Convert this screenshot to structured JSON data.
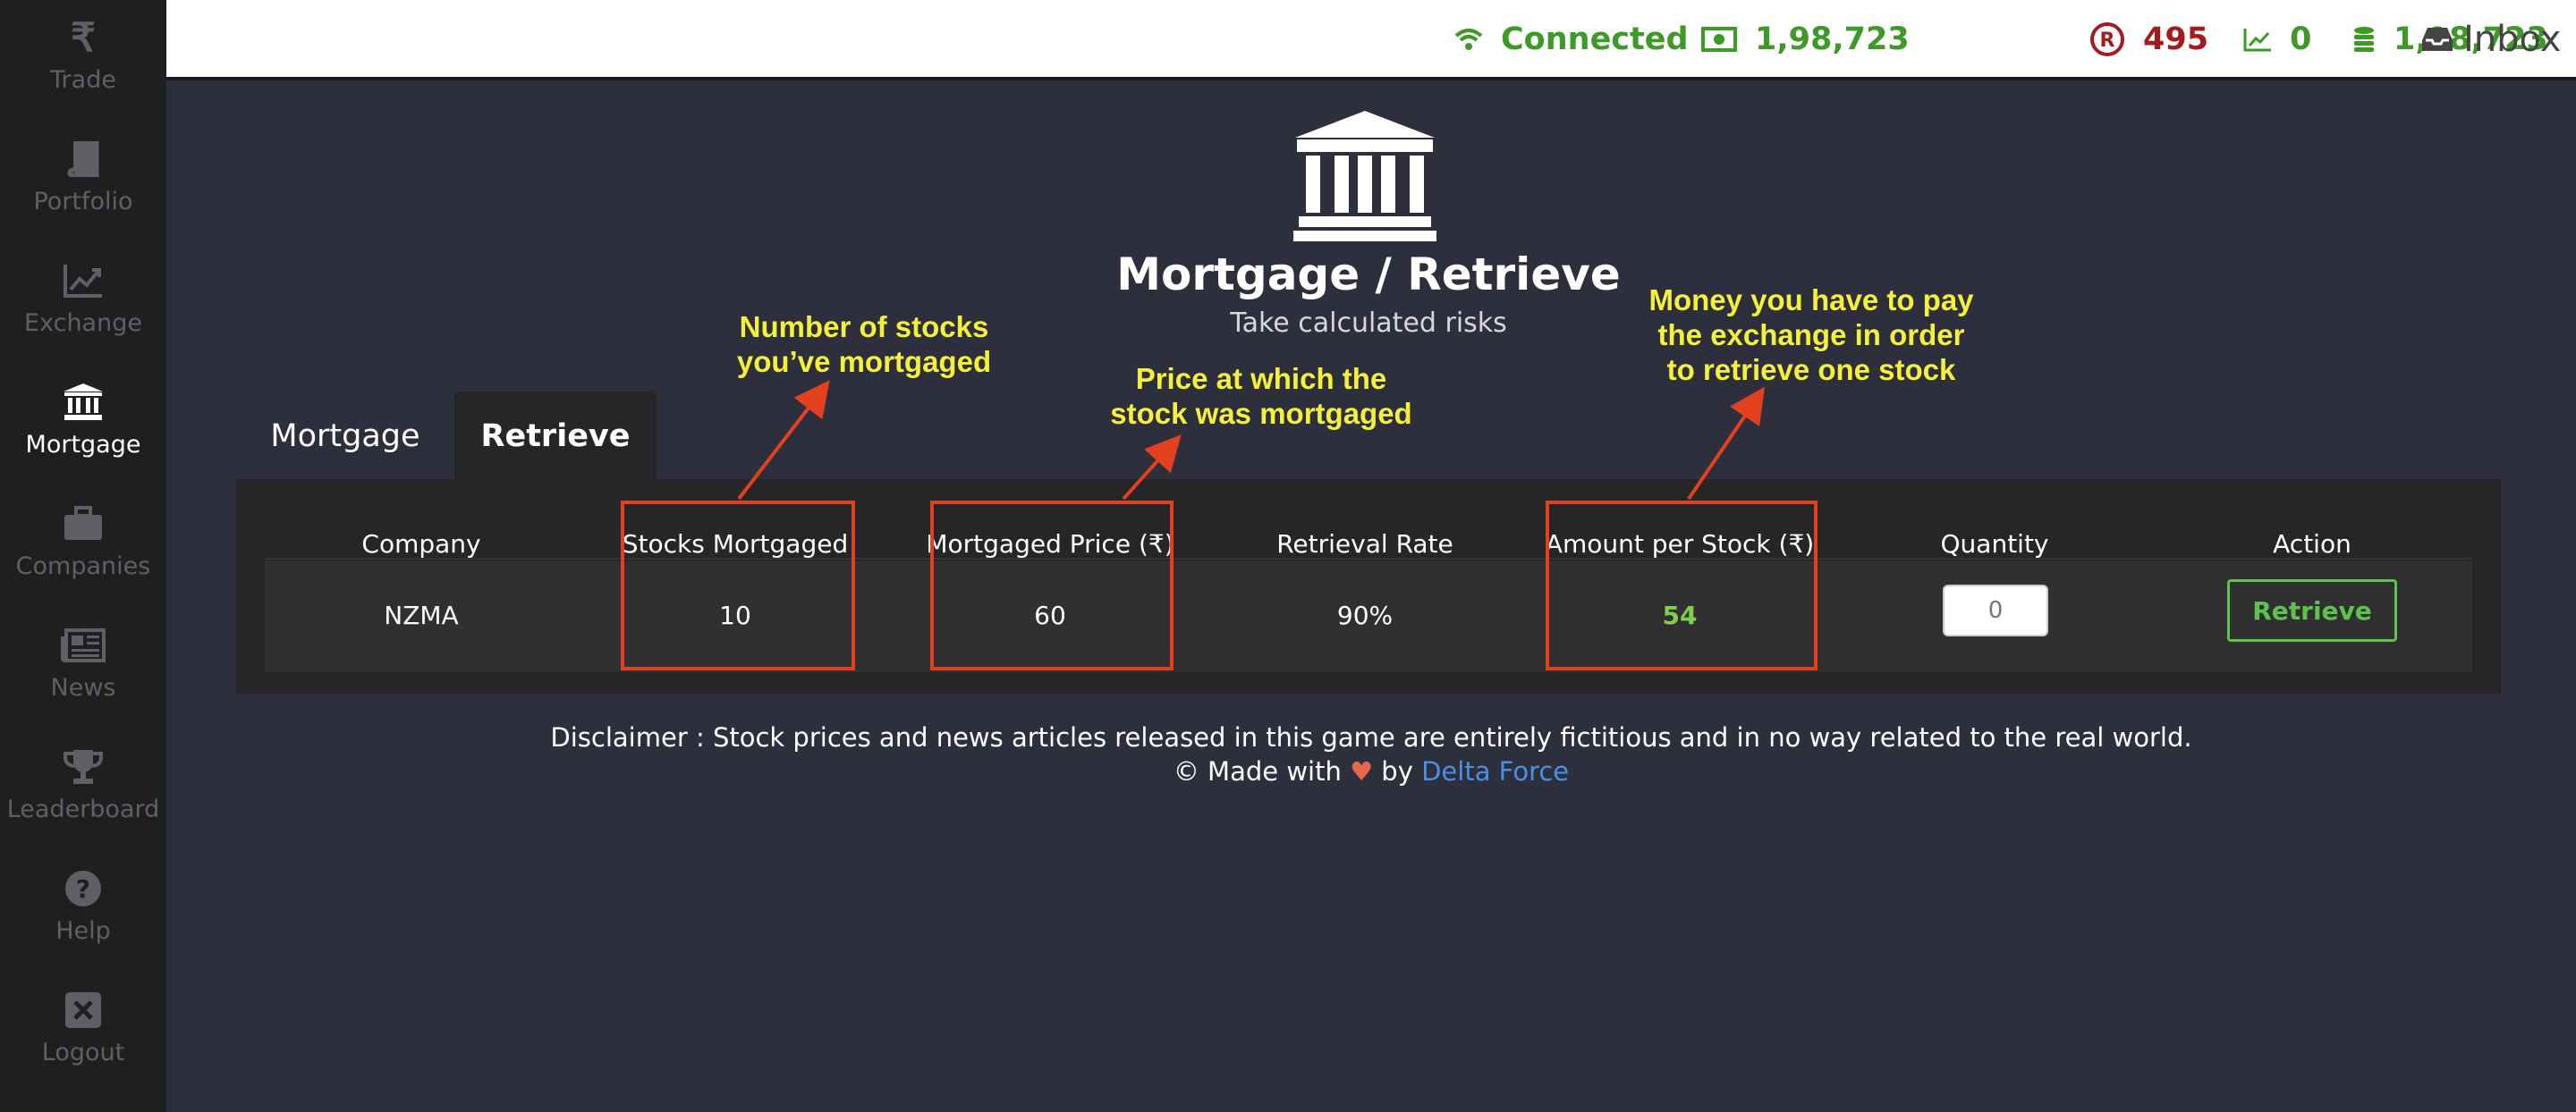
{
  "sidebar": {
    "items": [
      {
        "label": "Trade",
        "icon": "rupee-icon"
      },
      {
        "label": "Portfolio",
        "icon": "book-icon"
      },
      {
        "label": "Exchange",
        "icon": "chart-icon"
      },
      {
        "label": "Mortgage",
        "icon": "bank-icon",
        "active": true
      },
      {
        "label": "Companies",
        "icon": "briefcase-icon"
      },
      {
        "label": "News",
        "icon": "newspaper-icon"
      },
      {
        "label": "Leaderboard",
        "icon": "trophy-icon"
      },
      {
        "label": "Help",
        "icon": "question-icon"
      },
      {
        "label": "Logout",
        "icon": "close-box-icon"
      }
    ]
  },
  "topbar": {
    "connection": "Connected",
    "cash": "1,98,723",
    "reserved": "495",
    "stock_worth": "0",
    "total_worth": "1,98,723",
    "inbox": "Inbox"
  },
  "header": {
    "title": "Mortgage / Retrieve",
    "subtitle": "Take calculated risks"
  },
  "tabs": {
    "mortgage": "Mortgage",
    "retrieve": "Retrieve"
  },
  "table": {
    "headers": {
      "company": "Company",
      "stocks_mortgaged": "Stocks Mortgaged",
      "mortgaged_price": "Mortgaged Price (₹)",
      "retrieval_rate": "Retrieval Rate",
      "amount_per_stock": "Amount per Stock (₹)",
      "quantity": "Quantity",
      "action": "Action"
    },
    "row": {
      "company": "NZMA",
      "stocks_mortgaged": "10",
      "mortgaged_price": "60",
      "retrieval_rate": "90%",
      "amount_per_stock": "54",
      "quantity_value": "0",
      "action_label": "Retrieve"
    }
  },
  "annotations": {
    "stocks_note_1": "Number of stocks",
    "stocks_note_2": "you’ve mortgaged",
    "price_note_1": "Price at which the",
    "price_note_2": "stock was mortgaged",
    "amount_note_1": "Money you have to pay",
    "amount_note_2": "the exchange in order",
    "amount_note_3": "to retrieve one stock"
  },
  "footer": {
    "disclaimer": "Disclaimer : Stock prices and news articles released in this game are entirely fictitious and in no way related to the real world.",
    "made_with_prefix": "© Made with",
    "heart": "♥",
    "made_with_by": "by",
    "author": "Delta Force"
  },
  "colors": {
    "accent_green": "#3d9a27",
    "reserved_red": "#a51a1a",
    "annotation_yellow": "#f5f03a",
    "annotation_red": "#e2401f",
    "link_blue": "#4a90e2"
  }
}
